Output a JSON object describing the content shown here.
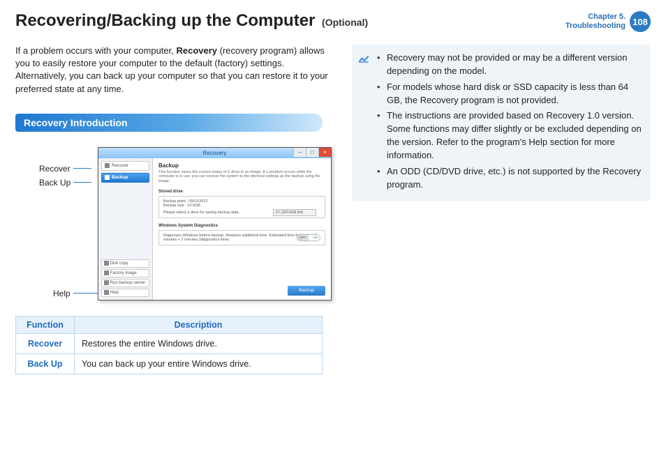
{
  "header": {
    "title_main": "Recovering/Backing up the Computer",
    "title_sub": "(Optional)",
    "chapter_line1": "Chapter 5.",
    "chapter_line2": "Troubleshooting",
    "page_number": "108"
  },
  "intro": {
    "part1": "If a problem occurs with your computer, ",
    "bold": "Recovery",
    "part2": " (recovery program) allows you to easily restore your computer to the default (factory) settings. Alternatively, you can back up your computer so that you can restore it to your preferred state at any time."
  },
  "section_title": "Recovery Introduction",
  "callouts": {
    "recover": "Recover",
    "backup": "Back Up",
    "help": "Help"
  },
  "app": {
    "title": "Recovery",
    "side": {
      "recover": "Recover",
      "backup": "Backup",
      "disk_copy": "Disk copy",
      "factory": "Factory image",
      "run_server": "Run backup server",
      "help": "Help"
    },
    "main": {
      "heading": "Backup",
      "desc": "This function saves the current status of C drive to an image.\nIf a problem occurs while the computer is in use, you can recover the system to the identical settings as the backup using the image.",
      "stored_drive": "Stored drive",
      "backup_point": "Backup point : 09/11/2012",
      "backup_size": "Backup size : 14.0GB",
      "select_drive": "Please select a drive for saving backup data.",
      "dropdown": "D:\\ (200.0GB left)",
      "diag_heading": "Windows System Diagnostics",
      "diag_desc": "Diagnoses Windows before backup. Requires additional time.\nEstimated time for backup 8 minutes + 2 minutes (diagnostics time)",
      "toggle_off": "OFF",
      "toggle_on": "ON",
      "button": "Backup"
    }
  },
  "table": {
    "h_function": "Function",
    "h_description": "Description",
    "rows": [
      {
        "fn": "Recover",
        "desc": "Restores the entire Windows drive."
      },
      {
        "fn": "Back Up",
        "desc": "You can back up your entire Windows drive."
      }
    ]
  },
  "notes": [
    "Recovery may not be provided or may be a different version depending on the model.",
    "For models whose hard disk or SSD capacity is less than 64 GB, the Recovery program is not provided.",
    "The instructions are provided based on Recovery 1.0 version. Some functions may differ slightly or be excluded depending on the version. Refer to the program's Help section for more information.",
    "An ODD (CD/DVD drive, etc.) is not supported by the Recovery program."
  ]
}
